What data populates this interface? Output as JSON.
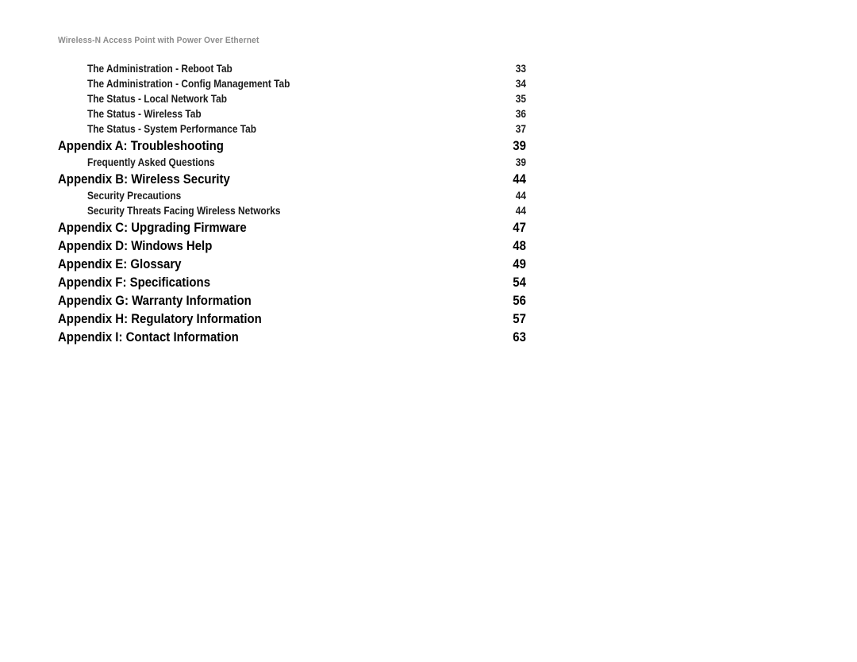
{
  "page": {
    "background_color": "#ffffff",
    "text_color": "#000000",
    "header_color": "#8c8c8c"
  },
  "header": {
    "running_title": "Wireless-N Access Point with Power Over Ethernet"
  },
  "toc": {
    "entries": [
      {
        "level": 2,
        "title": "The Administration - Reboot Tab",
        "page": "33"
      },
      {
        "level": 2,
        "title": "The Administration - Config Management Tab",
        "page": "34"
      },
      {
        "level": 2,
        "title": "The Status - Local Network Tab",
        "page": "35"
      },
      {
        "level": 2,
        "title": "The Status - Wireless Tab",
        "page": "36"
      },
      {
        "level": 2,
        "title": "The Status - System Performance Tab",
        "page": "37"
      },
      {
        "level": 1,
        "title": "Appendix A: Troubleshooting",
        "page": "39"
      },
      {
        "level": 2,
        "title": "Frequently Asked Questions",
        "page": "39"
      },
      {
        "level": 1,
        "title": "Appendix B: Wireless Security",
        "page": "44"
      },
      {
        "level": 2,
        "title": "Security Precautions",
        "page": "44"
      },
      {
        "level": 2,
        "title": "Security Threats Facing Wireless Networks",
        "page": "44"
      },
      {
        "level": 1,
        "title": "Appendix C: Upgrading Firmware",
        "page": "47"
      },
      {
        "level": 1,
        "title": "Appendix D: Windows Help",
        "page": "48"
      },
      {
        "level": 1,
        "title": "Appendix E: Glossary",
        "page": "49"
      },
      {
        "level": 1,
        "title": "Appendix F: Specifications",
        "page": "54"
      },
      {
        "level": 1,
        "title": "Appendix G: Warranty Information",
        "page": "56"
      },
      {
        "level": 1,
        "title": "Appendix H: Regulatory Information",
        "page": "57"
      },
      {
        "level": 1,
        "title": "Appendix I: Contact Information",
        "page": "63"
      }
    ]
  }
}
